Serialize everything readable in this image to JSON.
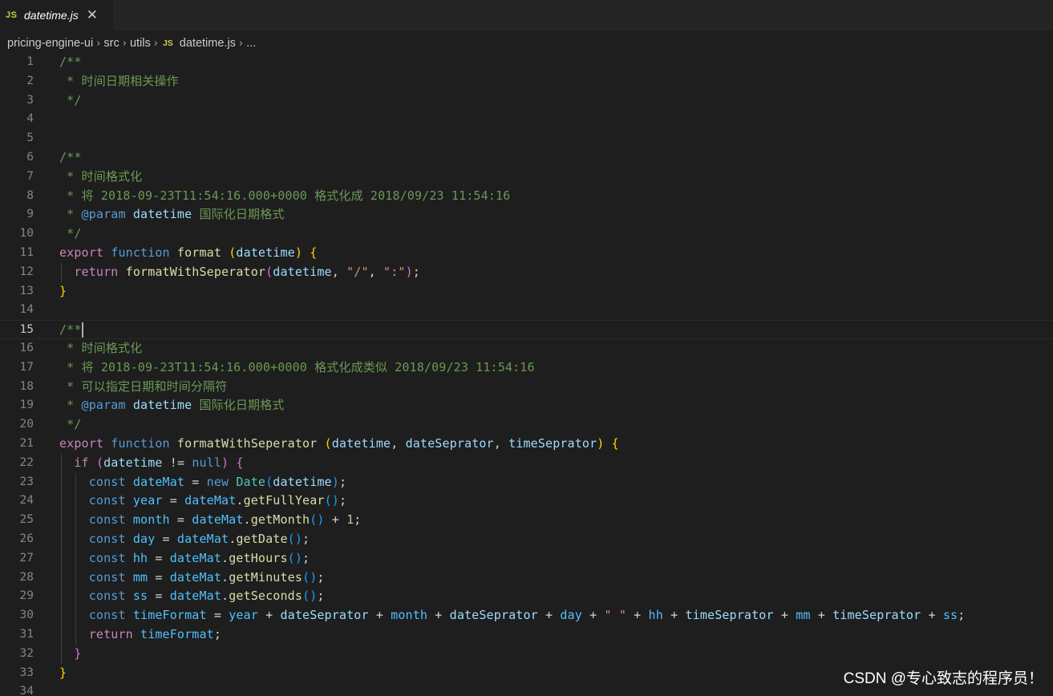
{
  "tab": {
    "icon": "JS",
    "title": "datetime.js",
    "close_glyph": "✕"
  },
  "breadcrumb": {
    "items": [
      "pricing-engine-ui",
      "src",
      "utils",
      "datetime.js",
      "..."
    ],
    "file_icon": "JS"
  },
  "code": {
    "cursor_line": 15,
    "lines": [
      [
        [
          "c",
          "/**"
        ]
      ],
      [
        [
          "c",
          " * 时间日期相关操作"
        ]
      ],
      [
        [
          "c",
          " */"
        ]
      ],
      [],
      [],
      [
        [
          "c",
          "/**"
        ]
      ],
      [
        [
          "c",
          " * 时间格式化"
        ]
      ],
      [
        [
          "c",
          " * 将 2018-09-23T11:54:16.000+0000 格式化成 2018/09/23 11:54:16"
        ]
      ],
      [
        [
          "c",
          " * "
        ],
        [
          "st",
          "@param"
        ],
        [
          "c",
          " "
        ],
        [
          "vr",
          "datetime"
        ],
        [
          "c",
          " 国际化日期格式"
        ]
      ],
      [
        [
          "c",
          " */"
        ]
      ],
      [
        [
          "kw",
          "export"
        ],
        [
          "pl",
          " "
        ],
        [
          "st",
          "function"
        ],
        [
          "pl",
          " "
        ],
        [
          "fn",
          "format"
        ],
        [
          "pl",
          " "
        ],
        [
          "b1",
          "("
        ],
        [
          "vr",
          "datetime"
        ],
        [
          "b1",
          ")"
        ],
        [
          "pl",
          " "
        ],
        [
          "b1",
          "{"
        ]
      ],
      [
        [
          "pl",
          "  "
        ],
        [
          "kw",
          "return"
        ],
        [
          "pl",
          " "
        ],
        [
          "fn",
          "formatWithSeperator"
        ],
        [
          "b2",
          "("
        ],
        [
          "vr",
          "datetime"
        ],
        [
          "pl",
          ", "
        ],
        [
          "str",
          "\"/\""
        ],
        [
          "pl",
          ", "
        ],
        [
          "str",
          "\":\""
        ],
        [
          "b2",
          ")"
        ],
        [
          "pl",
          ";"
        ]
      ],
      [
        [
          "b1",
          "}"
        ]
      ],
      [],
      [
        [
          "c",
          "/**"
        ],
        [
          "cursor",
          ""
        ]
      ],
      [
        [
          "c",
          " * 时间格式化"
        ]
      ],
      [
        [
          "c",
          " * 将 2018-09-23T11:54:16.000+0000 格式化成类似 2018/09/23 11:54:16"
        ]
      ],
      [
        [
          "c",
          " * 可以指定日期和时间分隔符"
        ]
      ],
      [
        [
          "c",
          " * "
        ],
        [
          "st",
          "@param"
        ],
        [
          "c",
          " "
        ],
        [
          "vr",
          "datetime"
        ],
        [
          "c",
          " 国际化日期格式"
        ]
      ],
      [
        [
          "c",
          " */"
        ]
      ],
      [
        [
          "kw",
          "export"
        ],
        [
          "pl",
          " "
        ],
        [
          "st",
          "function"
        ],
        [
          "pl",
          " "
        ],
        [
          "fn",
          "formatWithSeperator"
        ],
        [
          "pl",
          " "
        ],
        [
          "b1",
          "("
        ],
        [
          "vr",
          "datetime"
        ],
        [
          "pl",
          ", "
        ],
        [
          "vr",
          "dateSeprator"
        ],
        [
          "pl",
          ", "
        ],
        [
          "vr",
          "timeSeprator"
        ],
        [
          "b1",
          ")"
        ],
        [
          "pl",
          " "
        ],
        [
          "b1",
          "{"
        ]
      ],
      [
        [
          "pl",
          "  "
        ],
        [
          "kw",
          "if"
        ],
        [
          "pl",
          " "
        ],
        [
          "b2",
          "("
        ],
        [
          "vr",
          "datetime"
        ],
        [
          "pl",
          " != "
        ],
        [
          "st",
          "null"
        ],
        [
          "b2",
          ")"
        ],
        [
          "pl",
          " "
        ],
        [
          "b2",
          "{"
        ]
      ],
      [
        [
          "pl",
          "    "
        ],
        [
          "st",
          "const"
        ],
        [
          "pl",
          " "
        ],
        [
          "cn",
          "dateMat"
        ],
        [
          "pl",
          " = "
        ],
        [
          "st",
          "new"
        ],
        [
          "pl",
          " "
        ],
        [
          "ty",
          "Date"
        ],
        [
          "b3",
          "("
        ],
        [
          "vr",
          "datetime"
        ],
        [
          "b3",
          ")"
        ],
        [
          "pl",
          ";"
        ]
      ],
      [
        [
          "pl",
          "    "
        ],
        [
          "st",
          "const"
        ],
        [
          "pl",
          " "
        ],
        [
          "cn",
          "year"
        ],
        [
          "pl",
          " = "
        ],
        [
          "cn",
          "dateMat"
        ],
        [
          "pl",
          "."
        ],
        [
          "fn",
          "getFullYear"
        ],
        [
          "b3",
          "()"
        ],
        [
          "pl",
          ";"
        ]
      ],
      [
        [
          "pl",
          "    "
        ],
        [
          "st",
          "const"
        ],
        [
          "pl",
          " "
        ],
        [
          "cn",
          "month"
        ],
        [
          "pl",
          " = "
        ],
        [
          "cn",
          "dateMat"
        ],
        [
          "pl",
          "."
        ],
        [
          "fn",
          "getMonth"
        ],
        [
          "b3",
          "()"
        ],
        [
          "pl",
          " + "
        ],
        [
          "num",
          "1"
        ],
        [
          "pl",
          ";"
        ]
      ],
      [
        [
          "pl",
          "    "
        ],
        [
          "st",
          "const"
        ],
        [
          "pl",
          " "
        ],
        [
          "cn",
          "day"
        ],
        [
          "pl",
          " = "
        ],
        [
          "cn",
          "dateMat"
        ],
        [
          "pl",
          "."
        ],
        [
          "fn",
          "getDate"
        ],
        [
          "b3",
          "()"
        ],
        [
          "pl",
          ";"
        ]
      ],
      [
        [
          "pl",
          "    "
        ],
        [
          "st",
          "const"
        ],
        [
          "pl",
          " "
        ],
        [
          "cn",
          "hh"
        ],
        [
          "pl",
          " = "
        ],
        [
          "cn",
          "dateMat"
        ],
        [
          "pl",
          "."
        ],
        [
          "fn",
          "getHours"
        ],
        [
          "b3",
          "()"
        ],
        [
          "pl",
          ";"
        ]
      ],
      [
        [
          "pl",
          "    "
        ],
        [
          "st",
          "const"
        ],
        [
          "pl",
          " "
        ],
        [
          "cn",
          "mm"
        ],
        [
          "pl",
          " = "
        ],
        [
          "cn",
          "dateMat"
        ],
        [
          "pl",
          "."
        ],
        [
          "fn",
          "getMinutes"
        ],
        [
          "b3",
          "()"
        ],
        [
          "pl",
          ";"
        ]
      ],
      [
        [
          "pl",
          "    "
        ],
        [
          "st",
          "const"
        ],
        [
          "pl",
          " "
        ],
        [
          "cn",
          "ss"
        ],
        [
          "pl",
          " = "
        ],
        [
          "cn",
          "dateMat"
        ],
        [
          "pl",
          "."
        ],
        [
          "fn",
          "getSeconds"
        ],
        [
          "b3",
          "()"
        ],
        [
          "pl",
          ";"
        ]
      ],
      [
        [
          "pl",
          "    "
        ],
        [
          "st",
          "const"
        ],
        [
          "pl",
          " "
        ],
        [
          "cn",
          "timeFormat"
        ],
        [
          "pl",
          " = "
        ],
        [
          "cn",
          "year"
        ],
        [
          "pl",
          " + "
        ],
        [
          "vr",
          "dateSeprator"
        ],
        [
          "pl",
          " + "
        ],
        [
          "cn",
          "month"
        ],
        [
          "pl",
          " + "
        ],
        [
          "vr",
          "dateSeprator"
        ],
        [
          "pl",
          " + "
        ],
        [
          "cn",
          "day"
        ],
        [
          "pl",
          " + "
        ],
        [
          "str",
          "\" \""
        ],
        [
          "pl",
          " + "
        ],
        [
          "cn",
          "hh"
        ],
        [
          "pl",
          " + "
        ],
        [
          "vr",
          "timeSeprator"
        ],
        [
          "pl",
          " + "
        ],
        [
          "cn",
          "mm"
        ],
        [
          "pl",
          " + "
        ],
        [
          "vr",
          "timeSeprator"
        ],
        [
          "pl",
          " + "
        ],
        [
          "cn",
          "ss"
        ],
        [
          "pl",
          ";"
        ]
      ],
      [
        [
          "pl",
          "    "
        ],
        [
          "kw",
          "return"
        ],
        [
          "pl",
          " "
        ],
        [
          "cn",
          "timeFormat"
        ],
        [
          "pl",
          ";"
        ]
      ],
      [
        [
          "pl",
          "  "
        ],
        [
          "b2",
          "}"
        ]
      ],
      [
        [
          "b1",
          "}"
        ]
      ],
      []
    ]
  },
  "watermark": "CSDN @专心致志的程序员！"
}
